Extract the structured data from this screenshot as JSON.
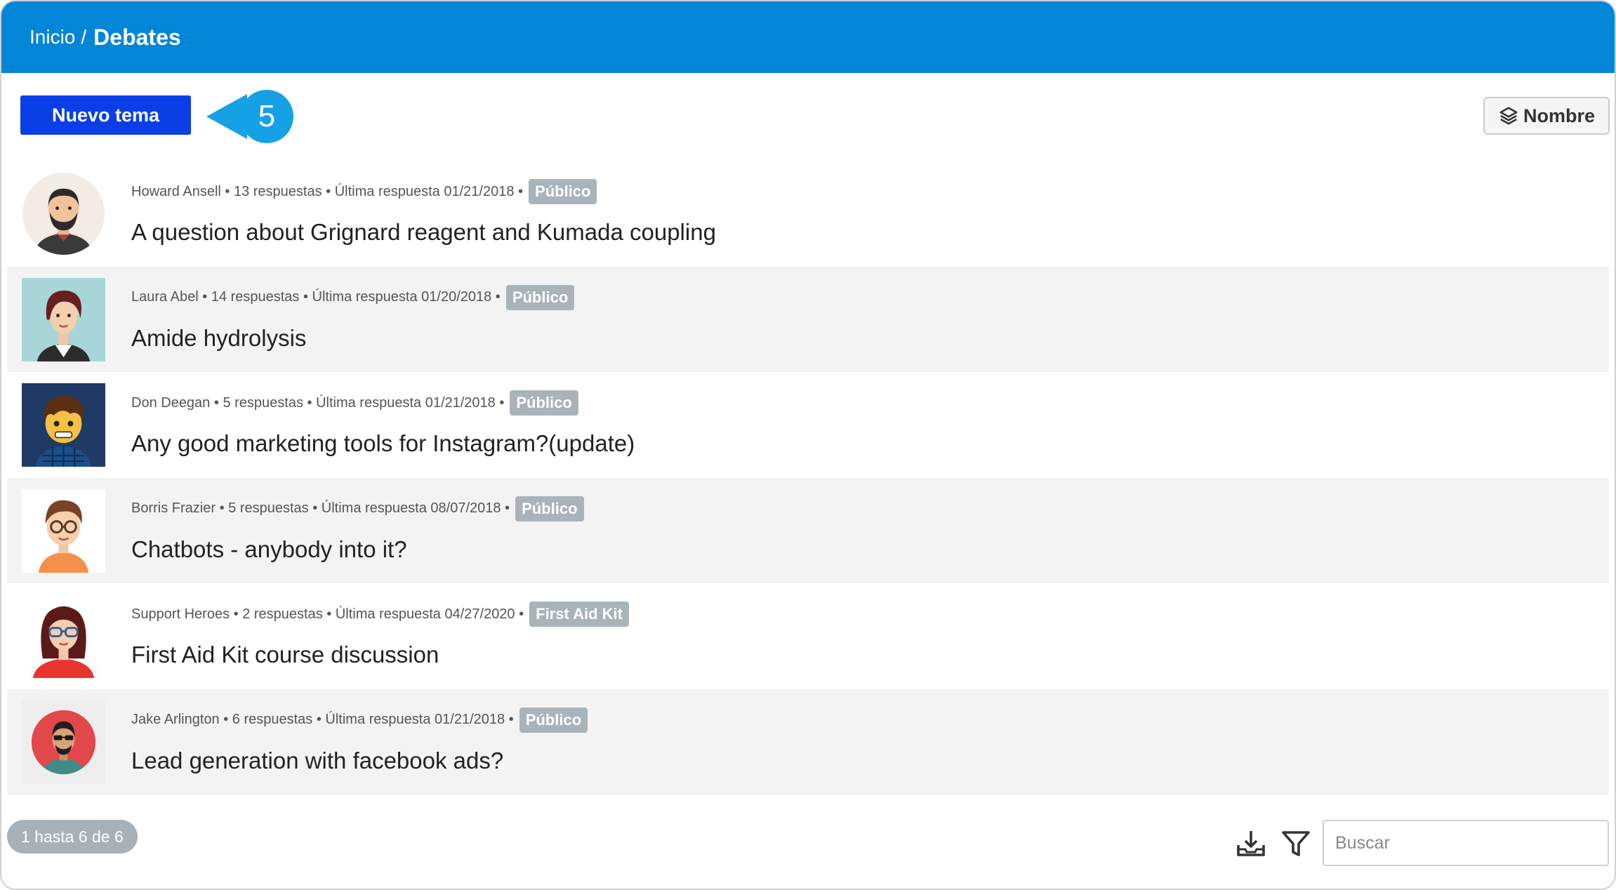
{
  "breadcrumb": {
    "home": "Inicio",
    "separator": "/",
    "current": "Debates"
  },
  "toolbar": {
    "new_topic_label": "Nuevo tema",
    "sort_label": "Nombre"
  },
  "callout": {
    "number": "5",
    "color": "#16a0e6"
  },
  "colors": {
    "header": "#0385d8",
    "primary_button": "#0a3fe8",
    "badge": "#a9b3ba"
  },
  "topics": [
    {
      "author": "Howard Ansell",
      "replies": "13 respuestas",
      "last": "Última respuesta 01/21/2018",
      "badge": "Público",
      "title": "A question about Grignard reagent and Kumada coupling",
      "avatar": "bearded-man-avatar"
    },
    {
      "author": "Laura Abel",
      "replies": "14 respuestas",
      "last": "Última respuesta 01/20/2018",
      "badge": "Público",
      "title": "Amide hydrolysis",
      "avatar": "woman-avatar"
    },
    {
      "author": "Don Deegan",
      "replies": "5 respuestas",
      "last": "Última respuesta 01/21/2018",
      "badge": "Público",
      "title": "Any good marketing tools for Instagram?(update)",
      "avatar": "cartoon-boy-avatar"
    },
    {
      "author": "Borris Frazier",
      "replies": "5 respuestas",
      "last": "Última respuesta 08/07/2018",
      "badge": "Público",
      "title": "Chatbots - anybody into it?",
      "avatar": "glasses-boy-avatar"
    },
    {
      "author": "Support Heroes",
      "replies": "2 respuestas",
      "last": "Última respuesta 04/27/2020",
      "badge": "First Aid Kit",
      "title": "First Aid Kit course discussion",
      "avatar": "glasses-woman-avatar"
    },
    {
      "author": "Jake Arlington",
      "replies": "6 respuestas",
      "last": "Última respuesta 01/21/2018",
      "badge": "Público",
      "title": "Lead generation with facebook ads?",
      "avatar": "sunglasses-man-avatar"
    }
  ],
  "pagination": {
    "label": "1 hasta 6 de 6"
  },
  "search": {
    "placeholder": "Buscar",
    "value": ""
  },
  "icons": {
    "download": "download-icon",
    "filter": "filter-icon",
    "sort": "layers-icon"
  }
}
